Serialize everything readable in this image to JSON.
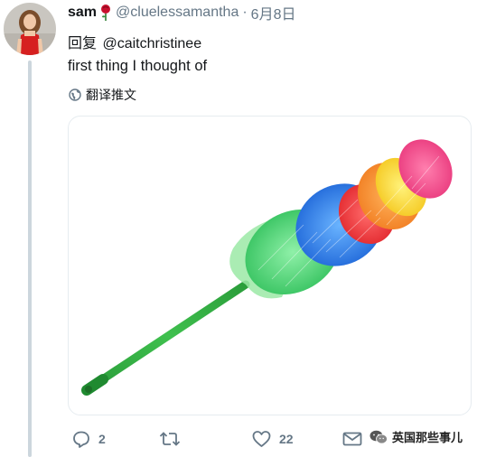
{
  "tweet": {
    "display_name": "sam",
    "handle": "@cluelessamantha",
    "separator": "·",
    "date": "6月8日",
    "reply_prefix": "回复",
    "reply_to": "@caitchristinee",
    "text": "first thing I thought of",
    "translate_label": "翻译推文",
    "avatar_icon": "profile-photo",
    "name_emoji": "rose-icon",
    "media_description_icon": "feather-duster-image"
  },
  "actions": {
    "reply_count": "2",
    "retweet_count": "",
    "like_count": "22",
    "message_count": ""
  },
  "watermark": {
    "text": "英国那些事儿",
    "icon": "wechat-icon"
  },
  "colors": {
    "text": "#14171a",
    "secondary": "#657786",
    "thread_line": "#ccd6dd",
    "media_border": "#e6ecf0"
  }
}
